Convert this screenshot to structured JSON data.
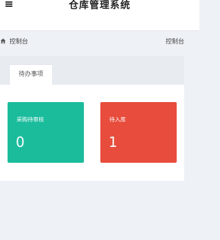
{
  "header": {
    "menu_icon": "menu-icon",
    "title": "仓库管理系统"
  },
  "breadcrumb": {
    "home_icon": "home-icon",
    "left_label": "控制台",
    "right_label": "控制台"
  },
  "panel": {
    "tab_label": "待办事项",
    "cards": [
      {
        "label": "采购待审核",
        "count": "0",
        "color": "#1abc9c"
      },
      {
        "label": "待入库",
        "count": "1",
        "color": "#e74c3c"
      }
    ]
  }
}
